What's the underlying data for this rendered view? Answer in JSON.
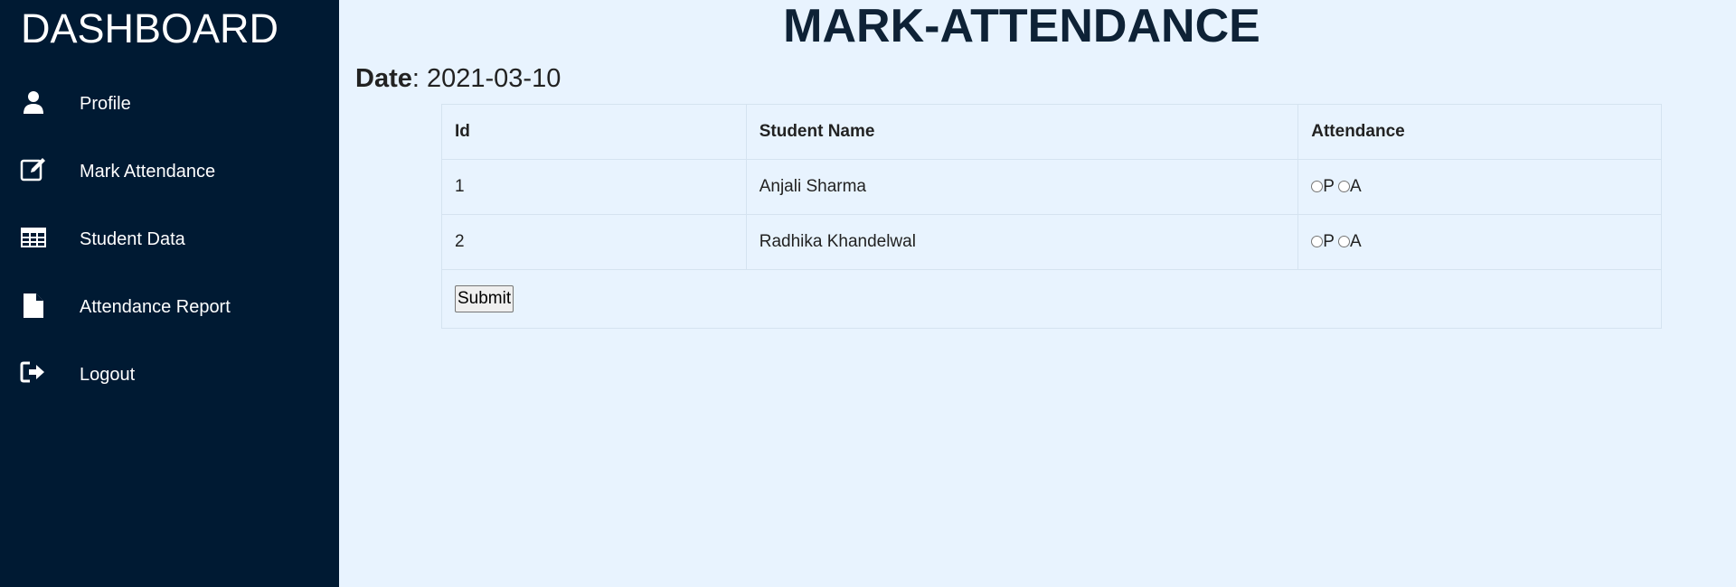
{
  "sidebar": {
    "brand": "DASHBOARD",
    "items": [
      {
        "label": "Profile",
        "icon": "user-icon"
      },
      {
        "label": "Mark Attendance",
        "icon": "edit-icon"
      },
      {
        "label": "Student Data",
        "icon": "table-icon"
      },
      {
        "label": "Attendance Report",
        "icon": "file-icon"
      },
      {
        "label": "Logout",
        "icon": "sign-out-icon"
      }
    ]
  },
  "main": {
    "title": "MARK-ATTENDANCE",
    "date_label": "Date",
    "date_sep": ": ",
    "date_value": "2021-03-10",
    "table": {
      "headers": [
        "Id",
        "Student Name",
        "Attendance"
      ],
      "rows": [
        {
          "id": "1",
          "name": "Anjali Sharma",
          "present_label": "P",
          "absent_label": "A"
        },
        {
          "id": "2",
          "name": "Radhika Khandelwal",
          "present_label": "P",
          "absent_label": "A"
        }
      ],
      "submit_label": "Submit"
    }
  },
  "colors": {
    "sidebar_bg": "#001a33",
    "page_bg": "#e8f3fe",
    "title_color": "#0e2236"
  }
}
